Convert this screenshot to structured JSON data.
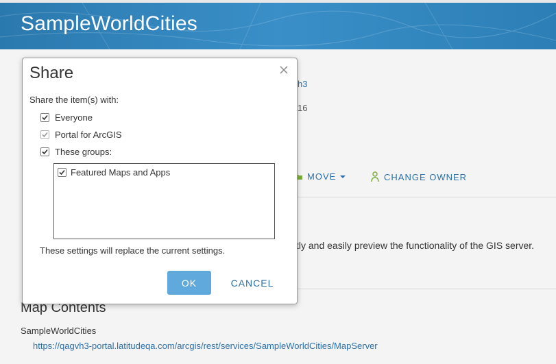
{
  "banner": {
    "title": "SampleWorldCities"
  },
  "background": {
    "owner_fragment": "h3",
    "date_fragment": "16",
    "move_label": "MOVE",
    "change_owner_label": "CHANGE OWNER",
    "description_fragment": "tly and easily preview the functionality of the GIS server.",
    "map_contents_title": "Map Contents",
    "layer_name": "SampleWorldCities",
    "layer_url": "https://qagvh3-portal.latitudeqa.com/arcgis/rest/services/SampleWorldCities/MapServer"
  },
  "dialog": {
    "title": "Share",
    "share_with_label": "Share the item(s) with:",
    "options": [
      {
        "label": "Everyone",
        "checked": true,
        "disabled": false
      },
      {
        "label": "Portal for ArcGIS",
        "checked": true,
        "disabled": true
      },
      {
        "label": "These groups:",
        "checked": true,
        "disabled": false
      }
    ],
    "groups": [
      {
        "label": "Featured Maps and Apps",
        "checked": true
      }
    ],
    "replace_note": "These settings will replace the current settings.",
    "ok_label": "OK",
    "cancel_label": "CANCEL"
  },
  "colors": {
    "banner": "#2c7fb6",
    "link": "#2c6fa8",
    "ok_button": "#5fa9dd"
  }
}
